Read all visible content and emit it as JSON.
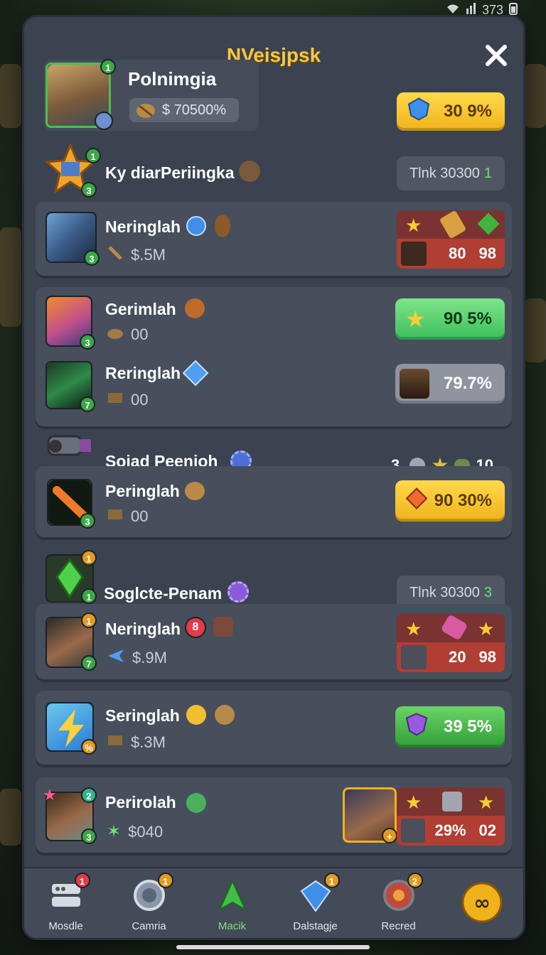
{
  "status_bar": {
    "battery": "373"
  },
  "window": {
    "title": "NVeisjpsk"
  },
  "player": {
    "name": "Polnimgia",
    "currency": "$ 70500%",
    "level_badge": "1",
    "progress_pill": "30 9%"
  },
  "sections": [
    {
      "title": "Ky diarPeriingka",
      "badge_top": "1",
      "badge_bot": "3",
      "tag_label": "Tlnk 30300",
      "tag_accent": "1"
    },
    {
      "title": "Sojad Peenjoh",
      "counter_left": "3.",
      "counter_right": "10"
    },
    {
      "title": "Soglcte-Penam",
      "badge_top": "1",
      "badge_bot": "1",
      "tag_label": "Tlnk 30300",
      "tag_accent": "3"
    }
  ],
  "rows": [
    {
      "name": "Neringlah",
      "sub": "$.5M",
      "badge": "3",
      "reward_a": "80",
      "reward_b": "98"
    },
    {
      "name": "Gerimlah",
      "sub": "00",
      "badge": "3",
      "pill": "90 5%"
    },
    {
      "name": "Reringlah",
      "sub": "00",
      "badge": "7",
      "pill": "79.7%"
    },
    {
      "name": "Peringlah",
      "sub": "00",
      "badge": "3",
      "pill": "90 30%"
    },
    {
      "name": "Neringlah",
      "sub": "$.9M",
      "badge_top": "1",
      "badge": "7",
      "reward_a": "20",
      "reward_b": "98",
      "side_badge": "8"
    },
    {
      "name": "Seringlah",
      "sub": "$.3M",
      "badge": "%",
      "pill": "39 5%"
    },
    {
      "name": "Perirolah",
      "sub": "$040",
      "badge_top": "2",
      "badge": "3",
      "reward_a": "29%",
      "reward_b": "02"
    }
  ],
  "nav": [
    {
      "label": "Mosdle",
      "badge": "1"
    },
    {
      "label": "Camria",
      "badge": "1"
    },
    {
      "label": "Macik",
      "badge": ""
    },
    {
      "label": "Dalstagje",
      "badge": "1"
    },
    {
      "label": "Recred",
      "badge": "2"
    },
    {
      "label": "",
      "badge": ""
    }
  ],
  "colors": {
    "accent": "#f5c842",
    "panel": "#3b4250",
    "card": "#474e5c",
    "green_pill": "#3cbf5c",
    "yellow_pill": "#f0b21a",
    "reward_red": "#b13e33"
  }
}
